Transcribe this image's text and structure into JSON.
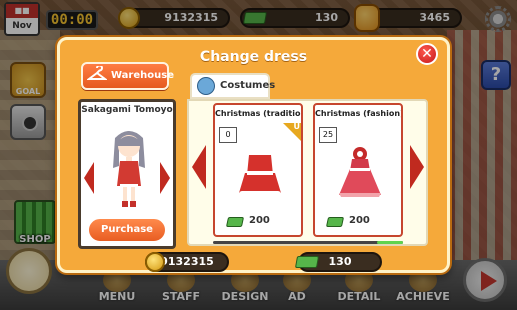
{
  "hud": {
    "calendar_month": "Nov",
    "timer": "00:00",
    "coins": "9132315",
    "cash": "130",
    "likes": "3465"
  },
  "side": {
    "goal_label": "GOAL",
    "shop_label": "SHOP",
    "help_label": "?"
  },
  "bottom_nav": {
    "items": [
      "MENU",
      "STAFF",
      "DESIGN",
      "AD",
      "DETAIL",
      "ACHIEVE"
    ]
  },
  "modal": {
    "title": "Change dress",
    "close_label": "✕",
    "warehouse_label": "Warehouse",
    "costumes_tab_label": "Costumes",
    "character": {
      "name": "Sakagami Tomoyo",
      "purchase_label": "Purchase"
    },
    "items": [
      {
        "name": "Christmas (traditional)",
        "count": "0",
        "badge": "U",
        "price": "200"
      },
      {
        "name": "Christmas (fashion)",
        "count": "25",
        "price": "200"
      }
    ],
    "footer": {
      "coins": "9132315",
      "cash": "130"
    }
  },
  "colors": {
    "modal_bg": "#f5a93a",
    "accent_orange": "#e85d22",
    "arrow_red": "#c02a1f",
    "cash_green": "#56b64a"
  }
}
